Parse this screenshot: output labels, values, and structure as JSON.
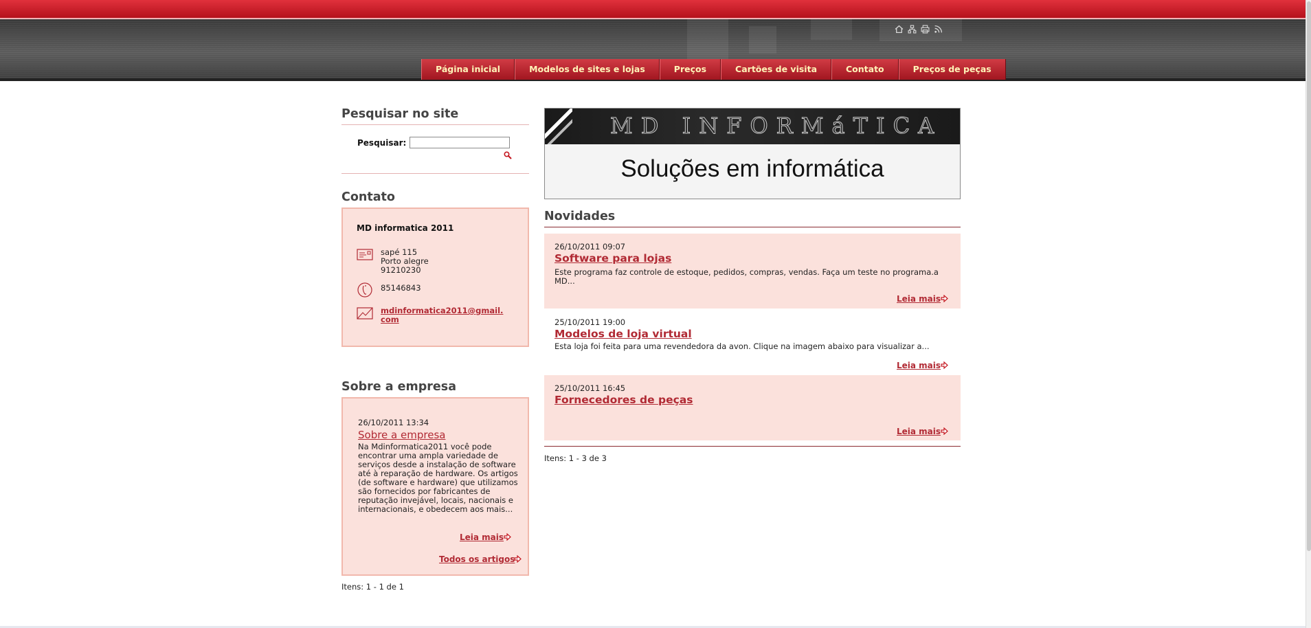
{
  "header": {
    "tools": [
      "home-icon",
      "sitemap-icon",
      "print-icon",
      "rss-icon"
    ],
    "nav": [
      "Página inicial",
      "Modelos de sites e lojas",
      "Preços",
      "Cartões de visita",
      "Contato",
      "Preços de peças"
    ]
  },
  "search": {
    "title": "Pesquisar no site",
    "label": "Pesquisar:",
    "value": "",
    "placeholder": ""
  },
  "contact": {
    "title": "Contato",
    "name": "MD informatica 2011",
    "address": [
      "sapé 115",
      "Porto alegre",
      "91210230"
    ],
    "phone": "85146843",
    "email_line1": "mdinformatica2011@gmail.",
    "email_line2": "com"
  },
  "about": {
    "title": "Sobre a empresa",
    "date": "26/10/2011 13:34",
    "link": "Sobre a empresa",
    "body": "Na Mdinformatica2011 você pode encontrar uma ampla variedade de serviços desde a instalação de software até à reparação de hardware. Os artigos (de software e hardware) que utilizamos são fornecidos por fabricantes de reputação invejável, locais, nacionais e internacionais, e obedecem aos mais...",
    "readmore": "Leia mais",
    "all_articles": "Todos os artigos",
    "count": "Itens: 1 - 1 de 1"
  },
  "banner": {
    "brand": "MD INFORMáTICA",
    "tagline": "Soluções em informática"
  },
  "news": {
    "title": "Novidades",
    "items": [
      {
        "date": "26/10/2011 09:07",
        "title": "Software para lojas",
        "body": "Este programa faz controle de estoque, pedidos, compras, vendas. Faça um teste no programa.a MD...",
        "readmore": "Leia mais"
      },
      {
        "date": "25/10/2011 19:00",
        "title": "Modelos de loja virtual",
        "body": "Esta loja foi feita para uma revendedora da avon. Clique na imagem abaixo para visualizar a...",
        "readmore": "Leia mais"
      },
      {
        "date": "25/10/2011 16:45",
        "title": "Fornecedores de peças",
        "body": "",
        "readmore": "Leia mais"
      }
    ],
    "count": "Itens: 1 - 3 de 3"
  },
  "colors": {
    "brand_red": "#c42630",
    "link_red": "#b12a34",
    "box_pink": "#fbe1dc",
    "nav_text": "#fff4b8"
  }
}
